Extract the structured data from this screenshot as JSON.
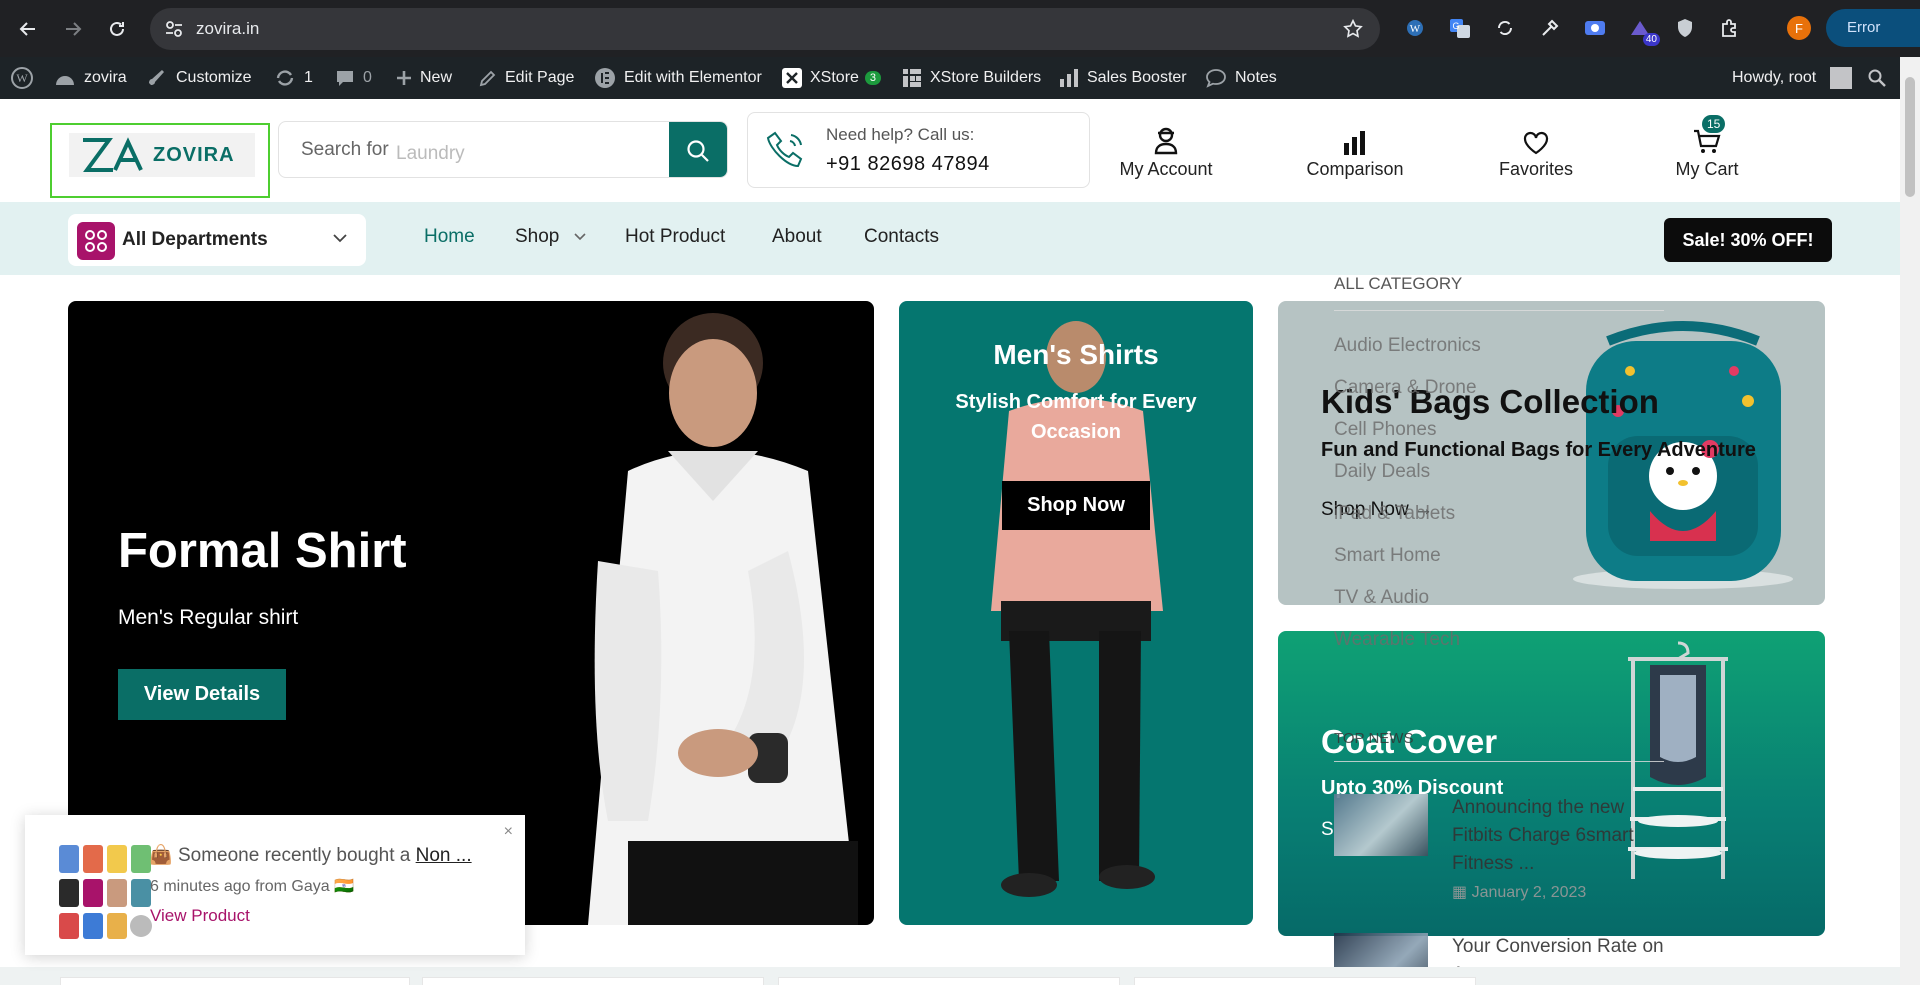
{
  "browser": {
    "url": "zovira.in",
    "error_label": "Error",
    "profile_initial": "F",
    "ext_badge": "40"
  },
  "adminbar": {
    "site": "zovira",
    "customize": "Customize",
    "updates": "1",
    "comments": "0",
    "new": "New",
    "edit_page": "Edit Page",
    "elementor": "Edit with Elementor",
    "xstore": "XStore",
    "xstore_count": "3",
    "builders": "XStore Builders",
    "booster": "Sales Booster",
    "notes": "Notes",
    "howdy": "Howdy, root"
  },
  "header": {
    "logo_text": "ZOVIRA",
    "search_label": "Search for",
    "search_placeholder": "Laundry",
    "help_text": "Need help? Call us:",
    "phone": "+91 82698 47894",
    "account": "My Account",
    "comparison": "Comparison",
    "favorites": "Favorites",
    "cart": "My Cart",
    "cart_count": "15"
  },
  "nav": {
    "departments": "All Departments",
    "items": [
      "Home",
      "Shop",
      "Hot Product",
      "About",
      "Contacts"
    ],
    "sale": "Sale! 30% OFF!"
  },
  "banners": {
    "formal": {
      "title": "Formal Shirt",
      "subtitle": "Men's Regular shirt",
      "button": "View Details"
    },
    "mens": {
      "title": "Men's Shirts",
      "subtitle": "Stylish Comfort for Every Occasion",
      "button": "Shop Now"
    },
    "kids": {
      "title": "Kids' Bags Collection",
      "subtitle": "Fun and Functional Bags for Every Adventure",
      "link": "Shop Now →"
    },
    "coat": {
      "title": "Coat Cover",
      "subtitle": "Upto 30% Discount",
      "link": "S"
    }
  },
  "overlay": {
    "category_header": "ALL CATEGORY",
    "categories": [
      "Audio Electronics",
      "Camera & Drone",
      "Cell Phones",
      "Daily Deals",
      "iPad & Tablets",
      "Smart Home",
      "TV & Audio",
      "Wearable Tech"
    ],
    "news_header": "TOP NEWS",
    "news": [
      {
        "title": "Announcing the new Fitbits Charge 6smart Fitness ...",
        "date": "January 2, 2023"
      },
      {
        "title": "Your Conversion Rate on Amazon",
        "date": ""
      }
    ]
  },
  "toast": {
    "prefix": "Someone recently bought a ",
    "product": "Non ...",
    "meta": "6 minutes ago from Gaya 🇮🇳",
    "view": "View Product",
    "close": "×"
  }
}
